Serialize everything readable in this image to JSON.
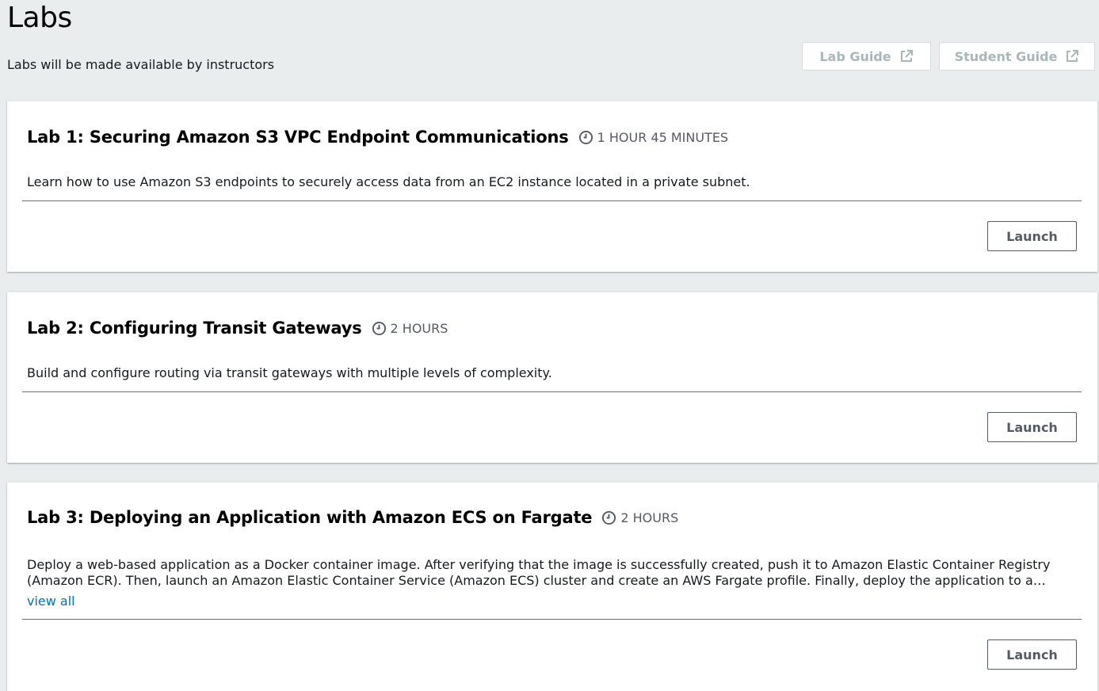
{
  "page": {
    "title": "Labs",
    "subtitle": "Labs will be made available by instructors"
  },
  "guides": {
    "lab_guide_label": "Lab Guide",
    "student_guide_label": "Student Guide",
    "icon": "external-link-icon",
    "disabled_color": "#aab7b8"
  },
  "labs": [
    {
      "title": "Lab 1: Securing Amazon S3 VPC Endpoint Communications",
      "duration": "1 HOUR 45 MINUTES",
      "description": "Learn how to use Amazon S3 endpoints to securely access data from an EC2 instance located in a private subnet.",
      "launch_label": "Launch"
    },
    {
      "title": "Lab 2: Configuring Transit Gateways",
      "duration": "2 HOURS",
      "description": "Build and configure routing via transit gateways with multiple levels of complexity.",
      "launch_label": "Launch"
    },
    {
      "title": "Lab 3: Deploying an Application with Amazon ECS on Fargate",
      "duration": "2 HOURS",
      "description": "Deploy a web-based application as a Docker container image. After verifying that the image is successfully created, push it to Amazon Elastic Container Registry (Amazon ECR). Then, launch an Amazon Elastic Container Service (Amazon ECS) cluster and create an AWS Fargate profile. Finally, deploy the application to a Fargate cluster.",
      "view_all_label": "view all",
      "launch_label": "Launch"
    }
  ],
  "colors": {
    "background": "#eaeded",
    "link": "#0073bb",
    "secondary_text": "#545b64"
  }
}
